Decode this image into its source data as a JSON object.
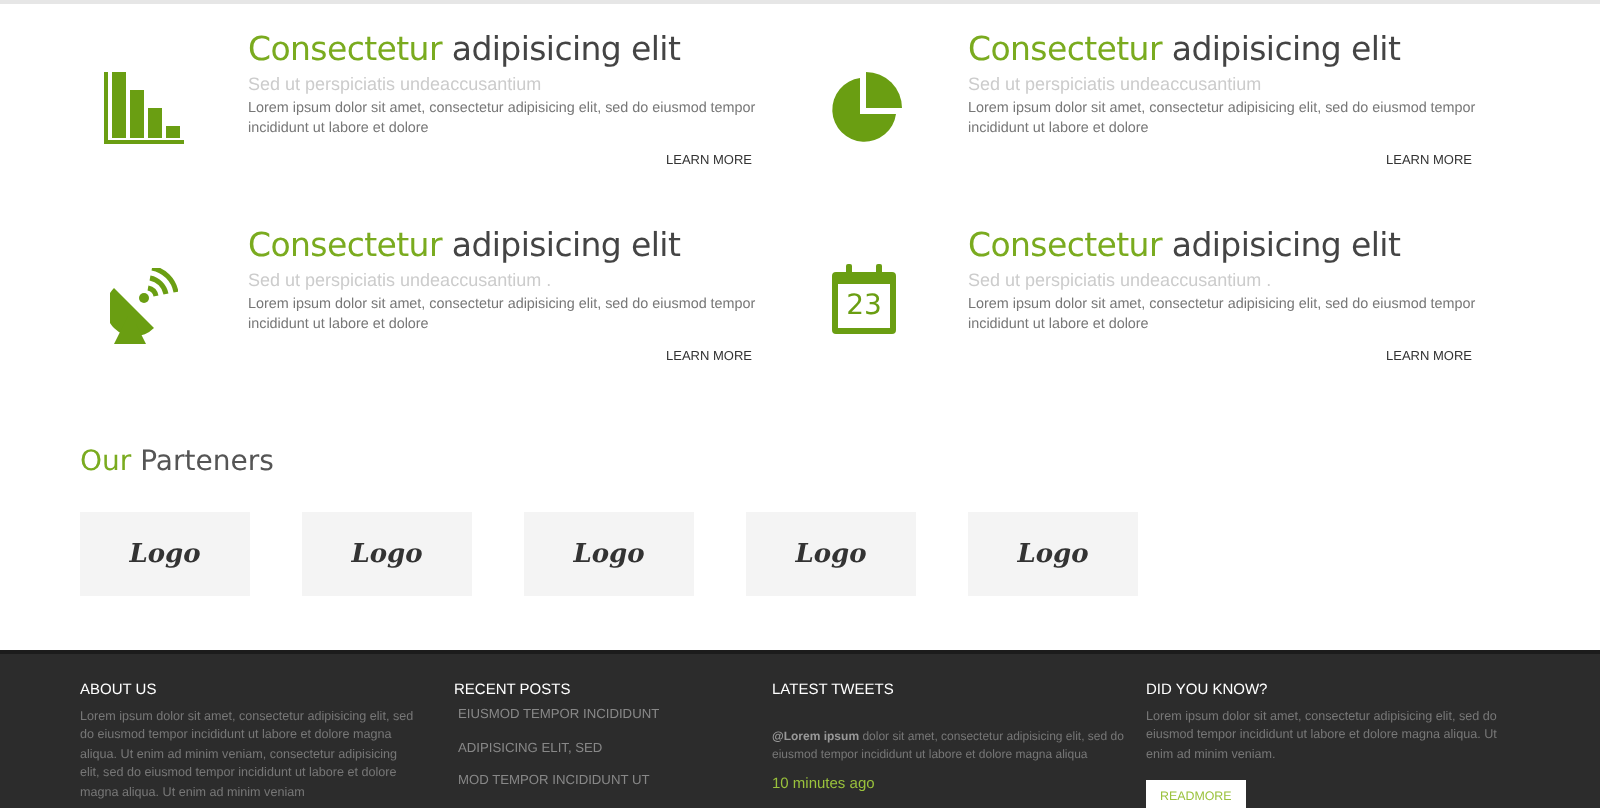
{
  "features": [
    {
      "kind": "bars",
      "title_accent": "Consectetur",
      "title_rest": "adipisicing elit",
      "subtitle": "Sed ut perspiciatis undeaccusantium",
      "body": "Lorem ipsum dolor sit amet, consectetur adipisicing elit, sed do eiusmod tempor incididunt ut labore et dolore",
      "link": "LEARN MORE"
    },
    {
      "kind": "pie",
      "title_accent": "Consectetur",
      "title_rest": "adipisicing elit",
      "subtitle": "Sed ut perspiciatis undeaccusantium",
      "body": "Lorem ipsum dolor sit amet, consectetur adipisicing elit, sed do eiusmod tempor incididunt ut labore et dolore",
      "link": "LEARN MORE"
    },
    {
      "kind": "dish",
      "title_accent": "Consectetur",
      "title_rest": "adipisicing elit",
      "subtitle": "Sed ut perspiciatis undeaccusantium .",
      "body": "Lorem ipsum dolor sit amet, consectetur adipisicing elit, sed do eiusmod tempor incididunt ut labore et dolore",
      "link": "LEARN MORE"
    },
    {
      "kind": "calendar",
      "icon_text": "23",
      "title_accent": "Consectetur",
      "title_rest": "adipisicing elit",
      "subtitle": "Sed ut perspiciatis undeaccusantium .",
      "body": "Lorem ipsum dolor sit amet, consectetur adipisicing elit, sed do eiusmod tempor incididunt ut labore et dolore",
      "link": "LEARN MORE"
    }
  ],
  "partners": {
    "title_accent": "Our",
    "title_rest": "Parteners",
    "logos": [
      "Logo",
      "Logo",
      "Logo",
      "Logo",
      "Logo"
    ]
  },
  "footer": {
    "about": {
      "heading": "ABOUT US",
      "text": "Lorem ipsum dolor sit amet, consectetur adipisicing elit, sed do eiusmod tempor incididunt ut labore et dolore magna aliqua. Ut enim ad minim veniam, consectetur adipisicing elit, sed do eiusmod tempor incididunt ut labore et dolore magna aliqua. Ut enim ad minim veniam"
    },
    "posts": {
      "heading": "RECENT POSTS",
      "items": [
        "EIUSMOD TEMPOR INCIDIDUNT",
        "ADIPISICING ELIT, SED",
        "MOD TEMPOR INCIDIDUNT UT"
      ]
    },
    "tweets": {
      "heading": "LATEST TWEETS",
      "text": "**@Lorem ipsum** dolor sit amet, consectetur adipisicing elit, sed do eiusmod tempor incididunt ut labore et dolore magna aliqua",
      "time": "10 minutes ago"
    },
    "know": {
      "heading": "DID YOU KNOW?",
      "text": "Lorem ipsum dolor sit amet, consectetur adipisicing elit, sed do eiusmod tempor incididunt ut labore et dolore magna aliqua. Ut enim ad minim veniam.",
      "button": "READMORE"
    }
  }
}
